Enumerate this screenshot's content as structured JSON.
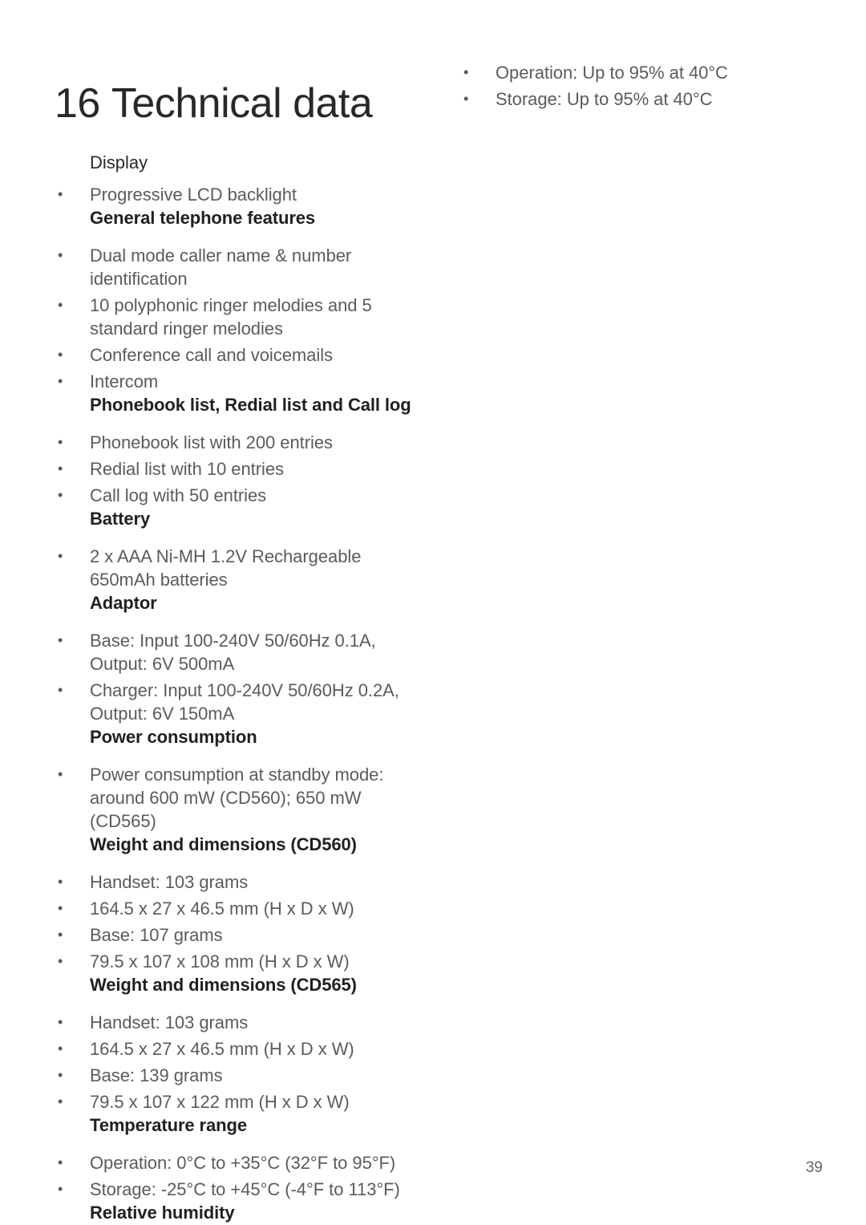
{
  "document": {
    "chapter_number": "16",
    "chapter_title": "Technical data",
    "page_number": "39"
  },
  "left_column": {
    "display": {
      "heading": "Display",
      "items": [
        "Progressive LCD backlight"
      ]
    },
    "general_telephone_features": {
      "heading": "General telephone features",
      "items": [
        "Dual mode caller name & number identification",
        "10 polyphonic ringer melodies and 5 standard ringer melodies",
        "Conference call and voicemails",
        "Intercom"
      ]
    },
    "phonebook_redial_calllog": {
      "heading": "Phonebook list, Redial list and Call log",
      "items": [
        "Phonebook list with 200 entries",
        "Redial list with 10 entries",
        "Call log with 50 entries"
      ]
    },
    "battery": {
      "heading": "Battery",
      "items": [
        "2 x AAA Ni-MH 1.2V Rechargeable 650mAh batteries"
      ]
    },
    "adaptor": {
      "heading": "Adaptor",
      "items": [
        "Base: Input 100-240V 50/60Hz 0.1A, Output: 6V 500mA",
        "Charger: Input 100-240V 50/60Hz 0.2A, Output: 6V 150mA"
      ]
    },
    "power_consumption": {
      "heading": "Power consumption",
      "items": [
        "Power consumption at standby mode: around 600 mW (CD560); 650 mW (CD565)"
      ]
    },
    "weight_dimensions_cd560": {
      "heading": "Weight and dimensions (CD560)",
      "items": [
        "Handset: 103 grams",
        "164.5 x 27 x 46.5 mm (H x D x W)",
        "Base: 107 grams",
        "79.5 x 107 x 108 mm (H x D x W)"
      ]
    },
    "weight_dimensions_cd565": {
      "heading": "Weight and dimensions (CD565)",
      "items": [
        "Handset: 103 grams",
        "164.5 x 27 x 46.5 mm (H x D x W)",
        "Base: 139 grams",
        "79.5 x 107 x 122 mm (H x D x W)"
      ]
    },
    "temperature_range": {
      "heading": "Temperature range",
      "items": [
        "Operation: 0°C to +35°C (32°F to 95°F)",
        "Storage: -25°C to +45°C (-4°F to 113°F)"
      ]
    },
    "relative_humidity": {
      "heading": "Relative humidity"
    }
  },
  "right_column": {
    "relative_humidity_items": [
      "Operation: Up to 95% at 40°C",
      "Storage: Up to 95% at 40°C"
    ]
  }
}
